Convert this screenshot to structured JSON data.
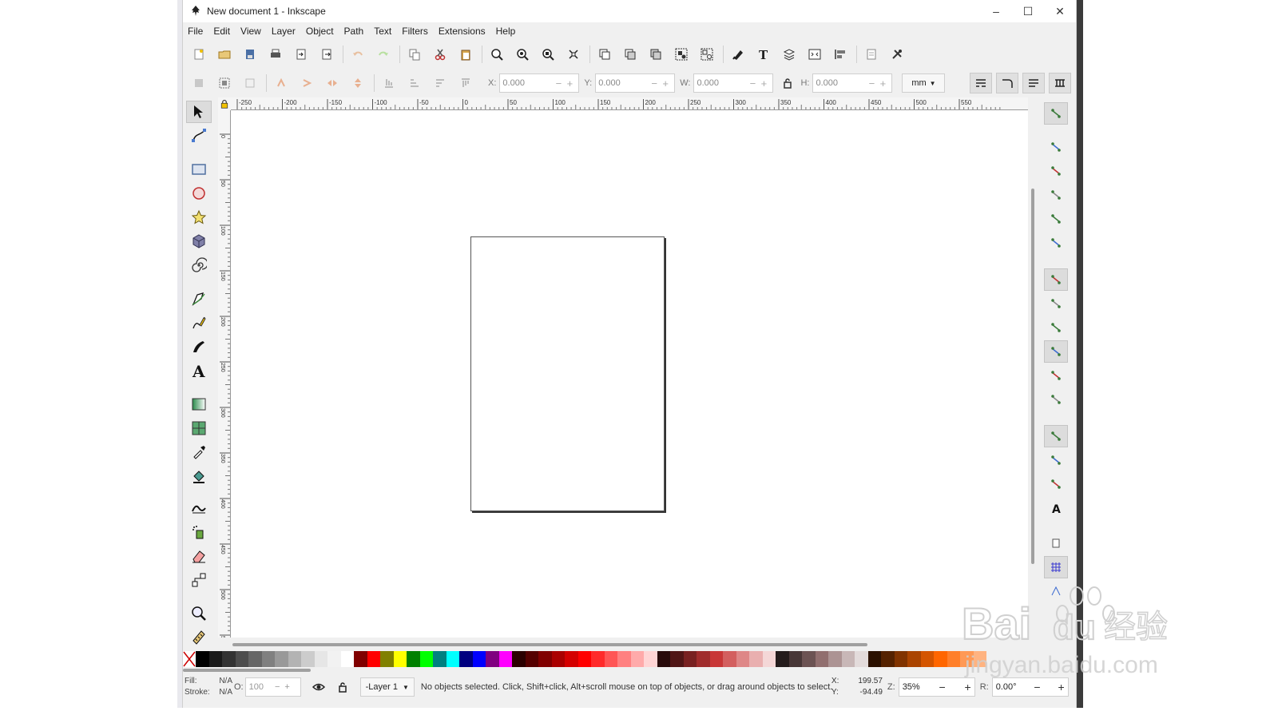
{
  "window": {
    "title": "New document 1 - Inkscape"
  },
  "window_controls": {
    "minimize": "–",
    "maximize": "☐",
    "close": "✕"
  },
  "menu": [
    {
      "label": "File"
    },
    {
      "label": "Edit"
    },
    {
      "label": "View"
    },
    {
      "label": "Layer"
    },
    {
      "label": "Object"
    },
    {
      "label": "Path"
    },
    {
      "label": "Text"
    },
    {
      "label": "Filters"
    },
    {
      "label": "Extensions"
    },
    {
      "label": "Help"
    }
  ],
  "command_bar": [
    "new-document-icon",
    "open-file-icon",
    "save-icon",
    "print-icon",
    "import-icon",
    "export-icon",
    "undo-icon",
    "redo-icon",
    "copy-icon",
    "cut-icon",
    "paste-icon",
    "zoom-selection-icon",
    "zoom-drawing-icon",
    "zoom-page-icon",
    "zoom-page-width-icon",
    "duplicate-icon",
    "clone-icon",
    "unlink-clone-icon",
    "group-icon",
    "ungroup-icon",
    "fill-stroke-icon",
    "text-font-icon",
    "layers-icon",
    "xml-editor-icon",
    "align-distribute-icon",
    "document-properties-icon",
    "preferences-icon"
  ],
  "controls": {
    "x_label": "X:",
    "x_value": "0.000",
    "y_label": "Y:",
    "y_value": "0.000",
    "w_label": "W:",
    "w_value": "0.000",
    "h_label": "H:",
    "h_value": "0.000",
    "unit": "mm"
  },
  "tools": [
    "selector-tool-icon",
    "node-tool-icon",
    "rectangle-tool-icon",
    "ellipse-tool-icon",
    "star-tool-icon",
    "3d-box-tool-icon",
    "spiral-tool-icon",
    "pen-tool-icon",
    "pencil-tool-icon",
    "calligraphy-tool-icon",
    "text-tool-icon",
    "gradient-tool-icon",
    "mesh-tool-icon",
    "dropper-tool-icon",
    "paint-bucket-tool-icon",
    "tweak-tool-icon",
    "spray-tool-icon",
    "eraser-tool-icon",
    "connector-tool-icon",
    "zoom-tool-icon",
    "measure-tool-icon"
  ],
  "ruler": {
    "h_labels": [
      "-250",
      "-200",
      "-150",
      "-100",
      "-50",
      "0",
      "50",
      "100",
      "150",
      "200",
      "250",
      "300",
      "350",
      "400",
      "450",
      "500",
      "550"
    ],
    "v_labels": [
      "0",
      "50",
      "100",
      "150",
      "200",
      "250",
      "300",
      "350",
      "400",
      "450",
      "500",
      "550",
      "600",
      "650"
    ]
  },
  "snap_icons": [
    "snap-enable-icon",
    "snap-bbox-icon",
    "snap-bbox-edge-icon",
    "snap-bbox-corner-icon",
    "snap-bbox-midpoint-icon",
    "snap-bbox-center-icon",
    "snap-nodes-icon",
    "snap-path-icon",
    "snap-intersection-icon",
    "snap-cusp-icon",
    "snap-smooth-icon",
    "snap-line-midpoint-icon",
    "snap-others-icon",
    "snap-object-center-icon",
    "snap-rotation-center-icon",
    "snap-text-baseline-icon",
    "snap-page-border-icon",
    "snap-grid-icon",
    "snap-guide-icon"
  ],
  "palette": {
    "colors": [
      "#000000",
      "#1a1a1a",
      "#333333",
      "#4d4d4d",
      "#666666",
      "#808080",
      "#999999",
      "#b3b3b3",
      "#cccccc",
      "#e6e6e6",
      "#f2f2f2",
      "#ffffff",
      "#800000",
      "#ff0000",
      "#808000",
      "#ffff00",
      "#008000",
      "#00ff00",
      "#008080",
      "#00ffff",
      "#000080",
      "#0000ff",
      "#800080",
      "#ff00ff",
      "#2b0000",
      "#550000",
      "#800000",
      "#aa0000",
      "#d40000",
      "#ff0000",
      "#ff2a2a",
      "#ff5555",
      "#ff8080",
      "#ffaaaa",
      "#ffd5d5",
      "#280b0b",
      "#501616",
      "#782121",
      "#a02c2c",
      "#c83737",
      "#d35f5f",
      "#de8787",
      "#e9afaf",
      "#f4d7d7",
      "#241c1c",
      "#483737",
      "#6c5353",
      "#916f6f",
      "#ac9393",
      "#c8b7b7",
      "#e3dbdb",
      "#2b1100",
      "#552200",
      "#803300",
      "#aa4400",
      "#d45500",
      "#ff6600",
      "#ff7f2a",
      "#ff9955",
      "#ffb380"
    ]
  },
  "status": {
    "fill_label": "Fill:",
    "fill_value": "N/A",
    "stroke_label": "Stroke:",
    "stroke_value": "N/A",
    "opacity_label": "O:",
    "opacity_value": "100",
    "layer": "-Layer 1",
    "message": "No objects selected. Click, Shift+click, Alt+scroll mouse on top of objects, or drag around objects to select.",
    "x_label": "X:",
    "x_value": "199.57",
    "y_label": "Y:",
    "y_value": "-94.49",
    "zoom_label": "Z:",
    "zoom_value": "35%",
    "rotation_label": "R:",
    "rotation_value": "0.00°"
  },
  "watermark": {
    "brand": "Bai",
    "brand2": "du",
    "brand_cn": "经验",
    "url": "jingyan.baidu.com"
  }
}
